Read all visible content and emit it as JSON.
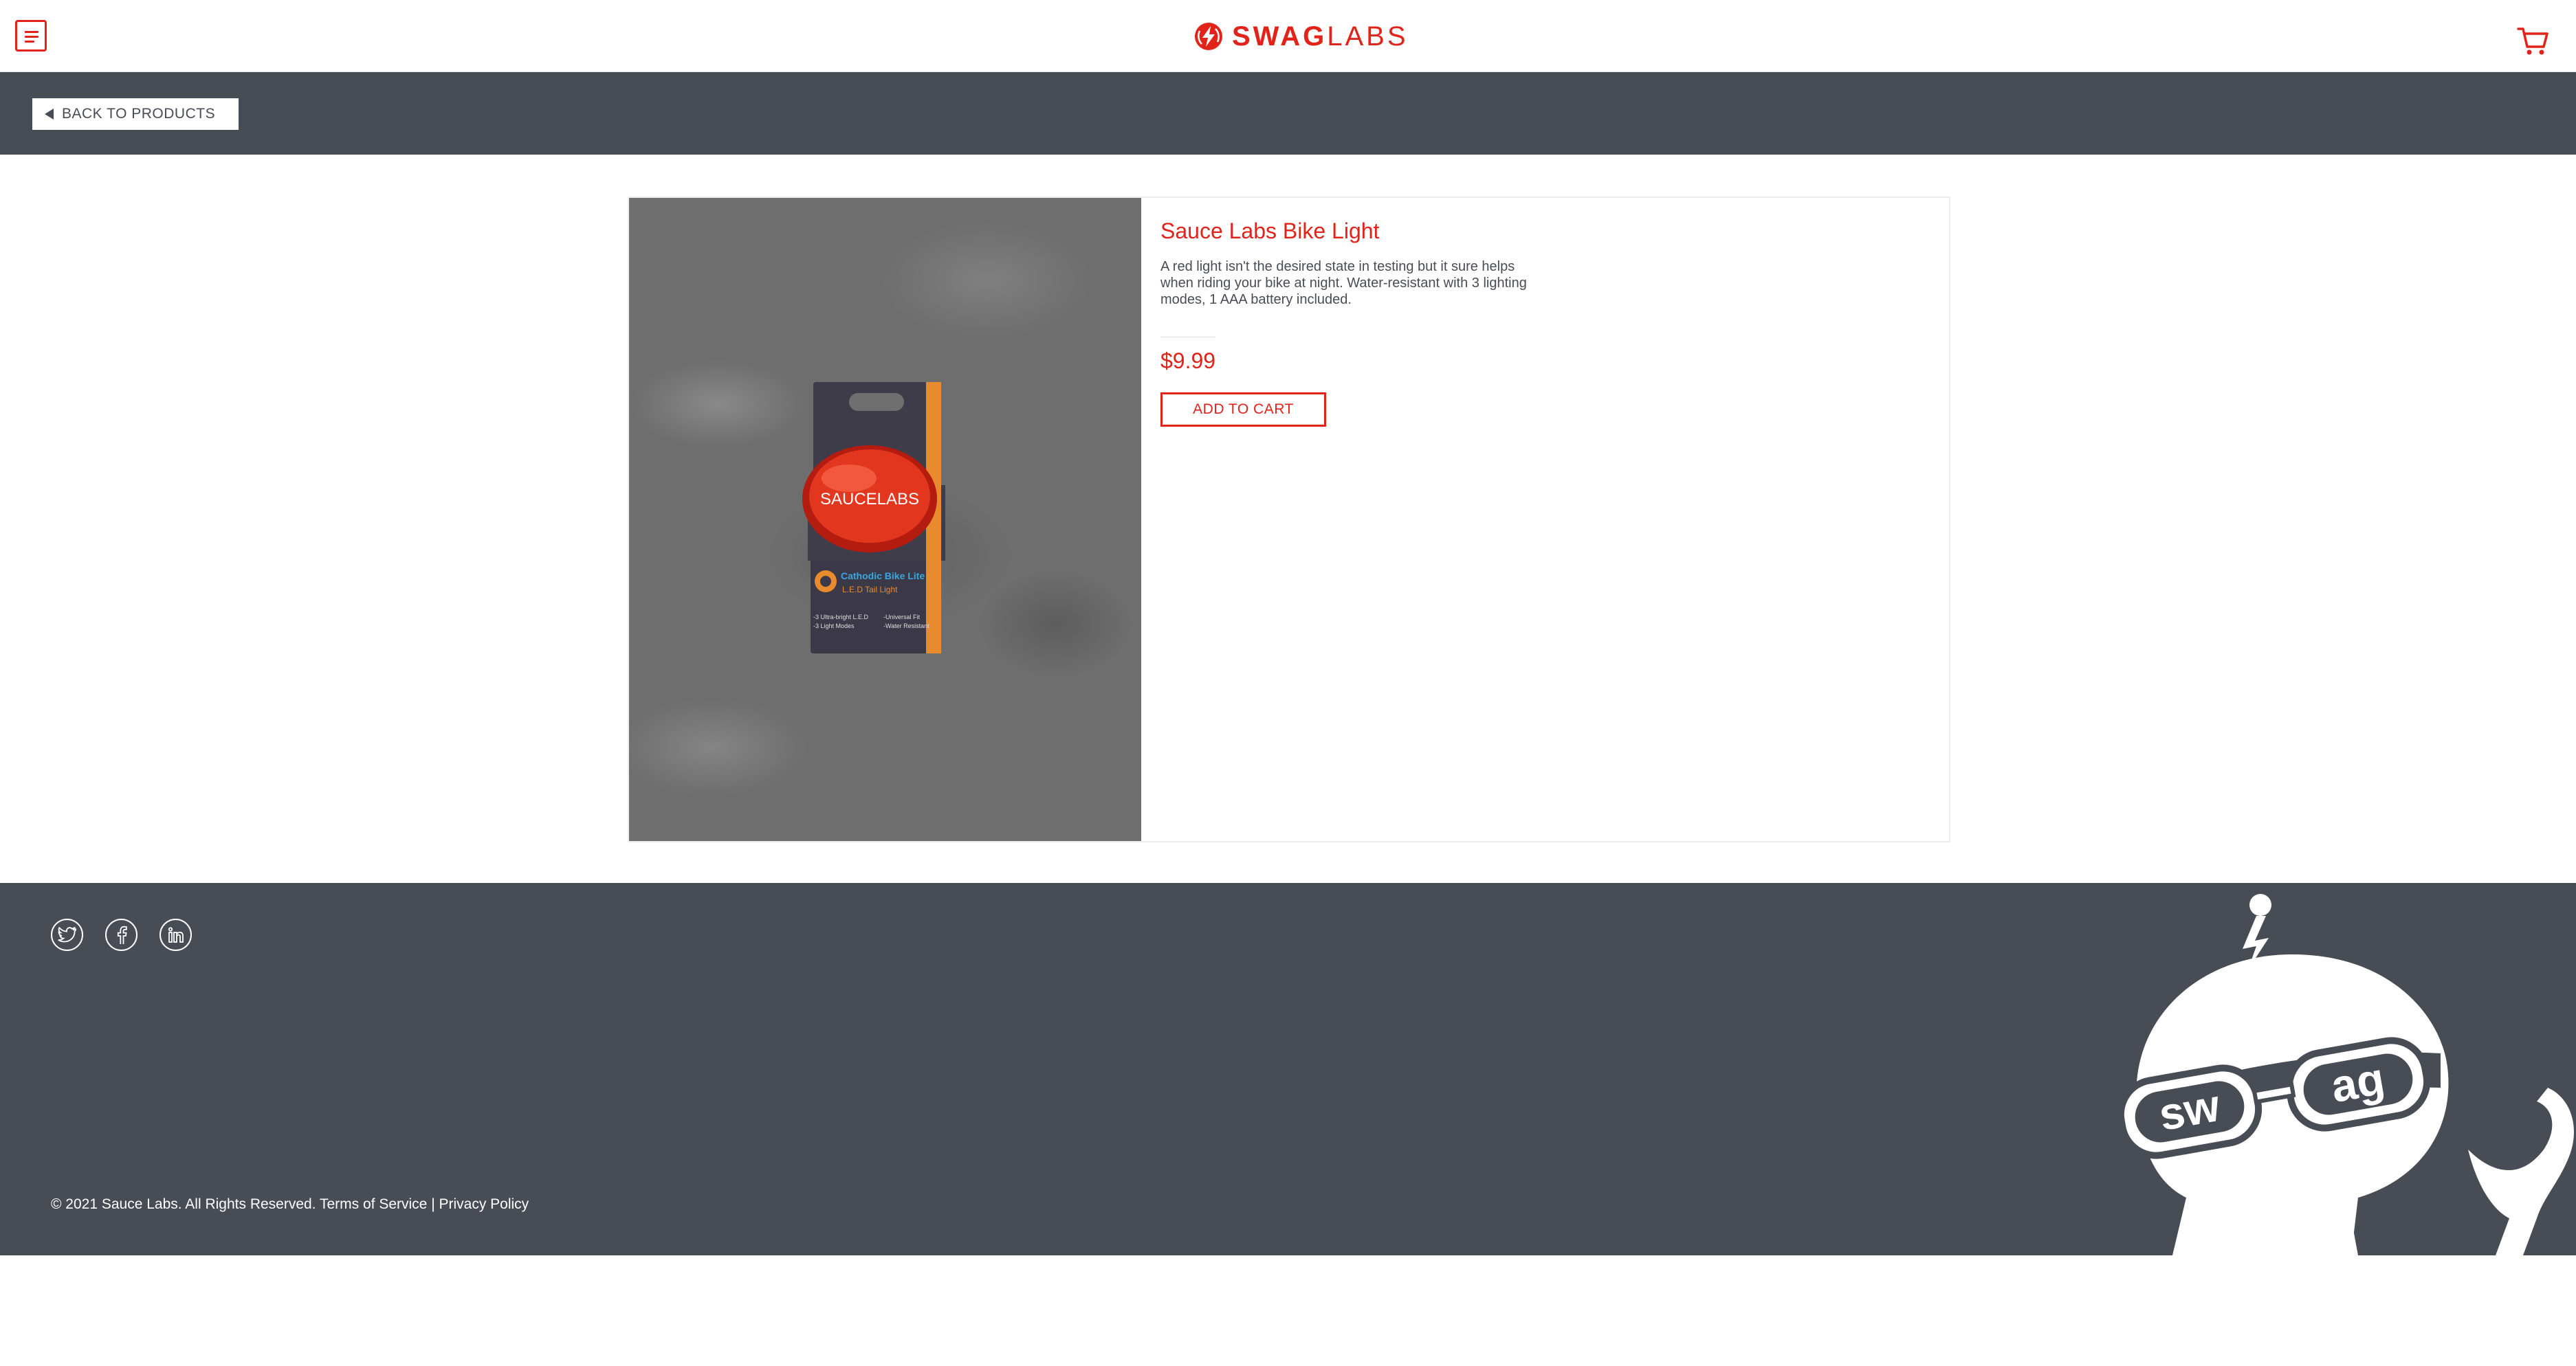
{
  "header": {
    "menu_icon": "hamburger-menu-icon",
    "logo_bold": "SWAG",
    "logo_light": "LABS",
    "cart_icon": "shopping-cart-icon"
  },
  "subheader": {
    "back_button_label": "BACK TO PRODUCTS",
    "back_icon": "triangle-left-icon"
  },
  "product": {
    "name": "Sauce Labs Bike Light",
    "description": "A red light isn't the desired state in testing but it sure helps when riding your bike at night. Water-resistant with 3 lighting modes, 1 AAA battery included.",
    "price": "$9.99",
    "add_to_cart_label": "ADD TO CART",
    "image_text": {
      "brand": "SAUCELABS",
      "box_title": "Cathodic Bike Lite",
      "box_subtitle": "L.E.D Tail Light",
      "feature_1": "-3 Ultra-bright L.E.D",
      "feature_2": "-3 Light Modes",
      "feature_3": "-Universal Fit",
      "feature_4": "-Water Resistant"
    }
  },
  "footer": {
    "social": [
      "twitter-icon",
      "facebook-icon",
      "linkedin-icon"
    ],
    "copyright": "© 2021 Sauce Labs. All Rights Reserved. Terms of Service | Privacy Policy",
    "mascot_text_left": "sw",
    "mascot_text_right": "ag"
  },
  "colors": {
    "accent": "#e2231a",
    "dark": "#484c55",
    "white": "#ffffff"
  }
}
